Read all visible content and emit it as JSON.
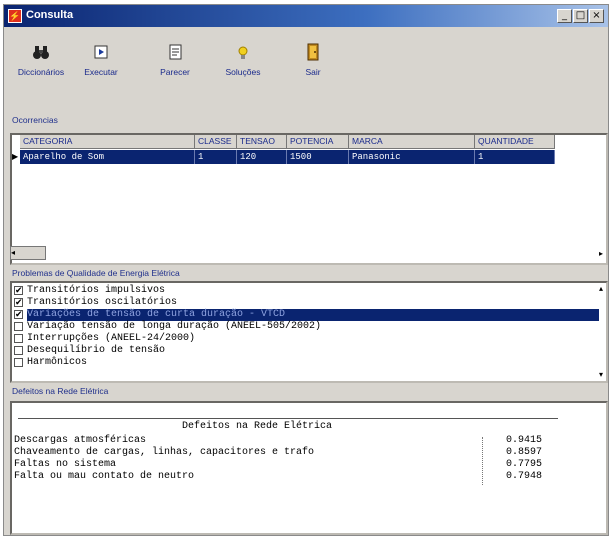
{
  "window": {
    "title": "Consulta",
    "min_label": "_",
    "max_label": "□",
    "close_label": "×"
  },
  "toolbar": {
    "items": [
      {
        "label": "Diccionários",
        "icon": "binoculars-icon"
      },
      {
        "label": "Executar",
        "icon": "execute-icon"
      },
      {
        "label": "Parecer",
        "icon": "report-icon"
      },
      {
        "label": "Soluções",
        "icon": "lightbulb-icon"
      },
      {
        "label": "Sair",
        "icon": "exit-door-icon"
      }
    ]
  },
  "sections": {
    "ocorrencias": "Ocorrencias",
    "problemas": "Problemas de Qualidade de Energia Elétrica",
    "defeitos": "Defeitos na Rede Elétrica"
  },
  "grid": {
    "columns": [
      "CATEGORIA",
      "CLASSE",
      "TENSAO",
      "POTENCIA",
      "MARCA",
      "QUANTIDADE"
    ],
    "rows": [
      [
        "Aparelho de Som",
        "1",
        "120",
        "1500",
        "Panasonic",
        "1"
      ]
    ]
  },
  "problems": [
    {
      "label": "Transitórios impulsivos",
      "checked": true,
      "selected": false
    },
    {
      "label": "Transitórios oscilatórios",
      "checked": true,
      "selected": false
    },
    {
      "label": "Variações de tensão de curta duração - VTCD",
      "checked": true,
      "selected": true
    },
    {
      "label": "Variação tensão de longa duração (ANEEL-505/2002)",
      "checked": false,
      "selected": false
    },
    {
      "label": "Interrupções (ANEEL-24/2000)",
      "checked": false,
      "selected": false
    },
    {
      "label": "Desequilíbrio de tensão",
      "checked": false,
      "selected": false
    },
    {
      "label": "Harmônicos",
      "checked": false,
      "selected": false
    }
  ],
  "report": {
    "title": "Defeitos na Rede Elétrica",
    "rows": [
      {
        "label": "Descargas atmosféricas",
        "value": "0.9415"
      },
      {
        "label": "Chaveamento de cargas, linhas, capacitores e trafo",
        "value": "0.8597"
      },
      {
        "label": "Faltas no sistema",
        "value": "0.7795"
      },
      {
        "label": "Falta ou mau contato de neutro",
        "value": "0.7948"
      }
    ]
  },
  "colors": {
    "titlebar": "#0a2470",
    "selection": "#0a2470",
    "label_blue": "#20308c"
  }
}
